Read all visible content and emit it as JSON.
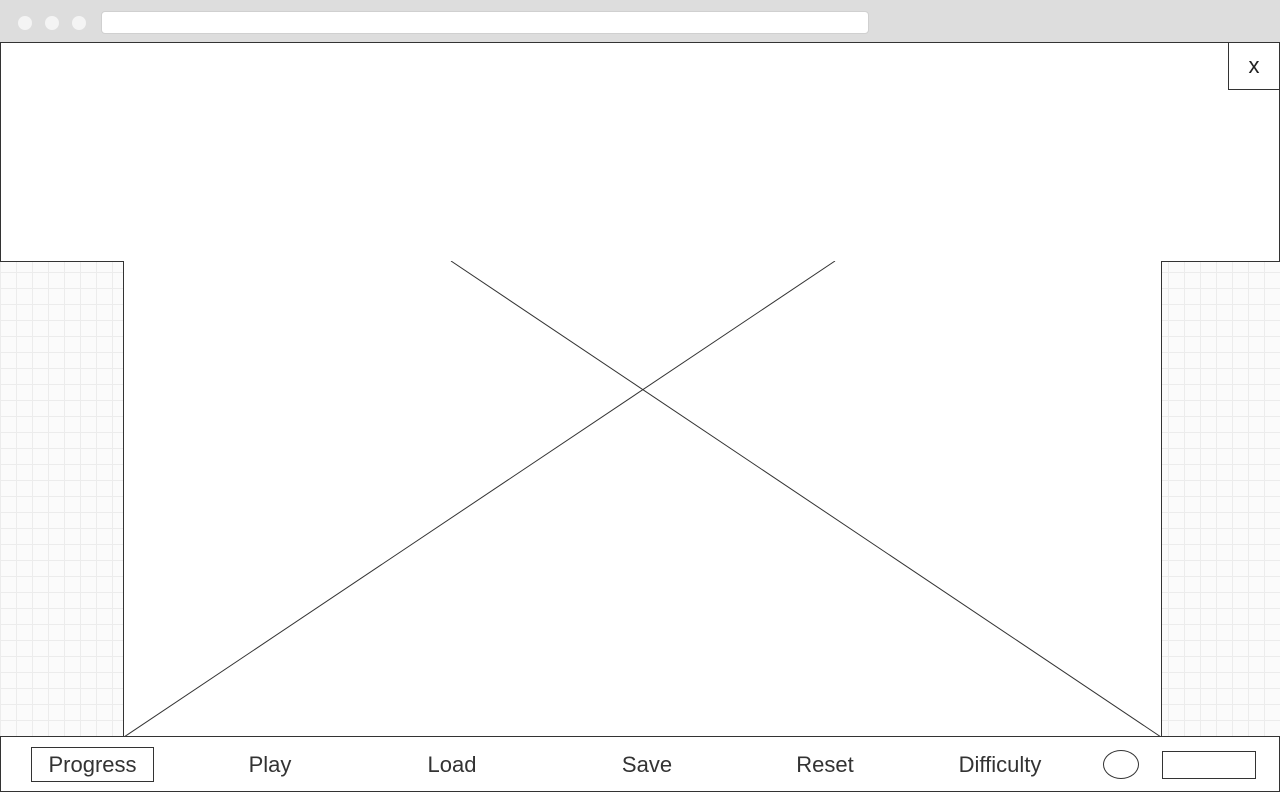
{
  "dialog": {
    "close_label": "x"
  },
  "toolbar": {
    "items": [
      {
        "label": "Progress"
      },
      {
        "label": "Play"
      },
      {
        "label": "Load"
      },
      {
        "label": "Save"
      },
      {
        "label": "Reset"
      },
      {
        "label": "Difficulty"
      }
    ],
    "input_value": ""
  }
}
